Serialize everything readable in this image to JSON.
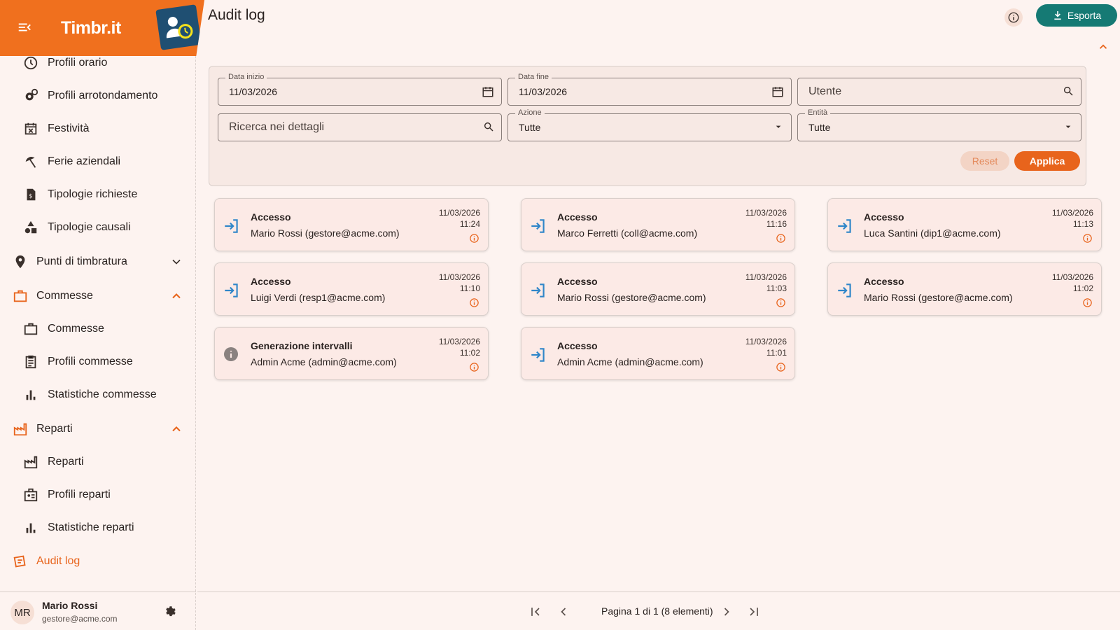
{
  "brand": {
    "name": "Timbr.it"
  },
  "sidebar": {
    "items": [
      {
        "label": "Profili orario",
        "icon": "clock-icon",
        "level": "sub"
      },
      {
        "label": "Profili arrotondamento",
        "icon": "gear-clock-icon",
        "level": "sub"
      },
      {
        "label": "Festività",
        "icon": "calendar-x-icon",
        "level": "sub"
      },
      {
        "label": "Ferie aziendali",
        "icon": "beach-icon",
        "level": "sub"
      },
      {
        "label": "Tipologie richieste",
        "icon": "document-icon",
        "level": "sub"
      },
      {
        "label": "Tipologie causali",
        "icon": "shapes-icon",
        "level": "sub"
      },
      {
        "label": "Punti di timbratura",
        "icon": "location-pin-icon",
        "level": "top",
        "chevron": "down"
      },
      {
        "label": "Commesse",
        "icon": "briefcase-icon",
        "level": "top",
        "chevron": "up"
      },
      {
        "label": "Commesse",
        "icon": "briefcase-icon",
        "level": "sub"
      },
      {
        "label": "Profili commesse",
        "icon": "list-doc-icon",
        "level": "sub"
      },
      {
        "label": "Statistiche commesse",
        "icon": "bar-chart-icon",
        "level": "sub"
      },
      {
        "label": "Reparti",
        "icon": "factory-icon",
        "level": "top",
        "chevron": "up"
      },
      {
        "label": "Reparti",
        "icon": "factory-icon",
        "level": "sub"
      },
      {
        "label": "Profili reparti",
        "icon": "id-badge-icon",
        "level": "sub"
      },
      {
        "label": "Statistiche reparti",
        "icon": "bar-chart-icon",
        "level": "sub"
      },
      {
        "label": "Audit log",
        "icon": "audit-icon",
        "level": "top",
        "active": true
      }
    ]
  },
  "user": {
    "initials": "MR",
    "name": "Mario Rossi",
    "email": "gestore@acme.com"
  },
  "header": {
    "title": "Audit log",
    "export_label": "Esporta"
  },
  "filters": {
    "start_label": "Data inizio",
    "start_value": "11/03/2026",
    "end_label": "Data fine",
    "end_value": "11/03/2026",
    "user_placeholder": "Utente",
    "details_placeholder": "Ricerca nei dettagli",
    "action_label": "Azione",
    "action_value": "Tutte",
    "entity_label": "Entità",
    "entity_value": "Tutte",
    "reset_label": "Reset",
    "apply_label": "Applica"
  },
  "entries": [
    {
      "action": "Accesso",
      "user": "Mario Rossi (gestore@acme.com)",
      "date": "11/03/2026",
      "time": "11:24",
      "icon": "login-icon"
    },
    {
      "action": "Accesso",
      "user": "Marco Ferretti (coll@acme.com)",
      "date": "11/03/2026",
      "time": "11:16",
      "icon": "login-icon"
    },
    {
      "action": "Accesso",
      "user": "Luca Santini (dip1@acme.com)",
      "date": "11/03/2026",
      "time": "11:13",
      "icon": "login-icon"
    },
    {
      "action": "Accesso",
      "user": "Luigi Verdi (resp1@acme.com)",
      "date": "11/03/2026",
      "time": "11:10",
      "icon": "login-icon"
    },
    {
      "action": "Accesso",
      "user": "Mario Rossi (gestore@acme.com)",
      "date": "11/03/2026",
      "time": "11:03",
      "icon": "login-icon"
    },
    {
      "action": "Accesso",
      "user": "Mario Rossi (gestore@acme.com)",
      "date": "11/03/2026",
      "time": "11:02",
      "icon": "login-icon"
    },
    {
      "action": "Generazione intervalli",
      "user": "Admin Acme (admin@acme.com)",
      "date": "11/03/2026",
      "time": "11:02",
      "icon": "info-filled-icon"
    },
    {
      "action": "Accesso",
      "user": "Admin Acme (admin@acme.com)",
      "date": "11/03/2026",
      "time": "11:01",
      "icon": "login-icon"
    }
  ],
  "pagination": {
    "text": "Pagina 1 di 1 (8 elementi)"
  },
  "colors": {
    "primary": "#e8641c",
    "teal": "#157a74",
    "background": "#fdf3f0",
    "card": "#fceae6",
    "login_icon": "#2f86c9"
  }
}
